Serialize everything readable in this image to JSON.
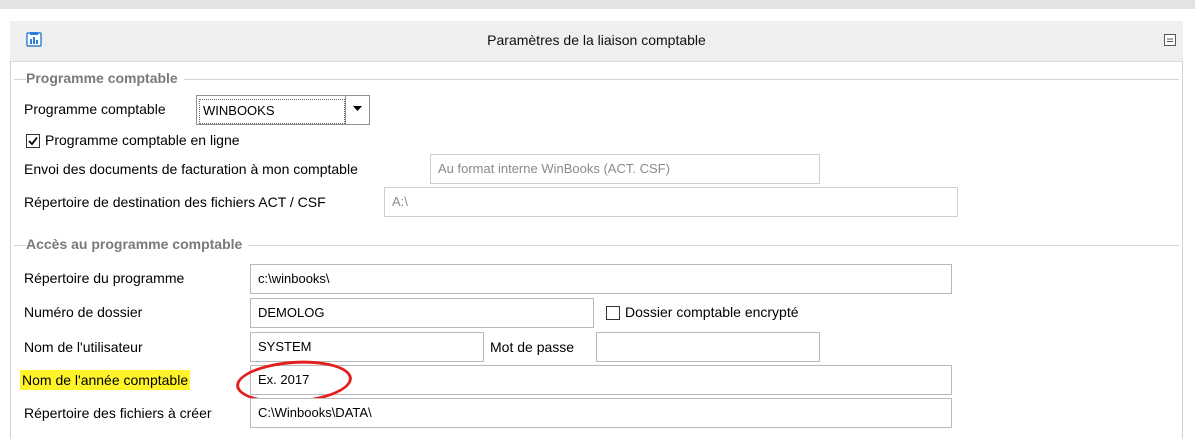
{
  "window": {
    "title": "Paramètres de la liaison comptable"
  },
  "sections": {
    "programme": {
      "heading": "Programme comptable",
      "program_label": "Programme comptable",
      "program_value": "WINBOOKS",
      "online_label": "Programme comptable en ligne",
      "online_checked": true,
      "envoi_label": "Envoi des documents de facturation à mon comptable",
      "envoi_value": "Au format interne WinBooks (ACT. CSF)",
      "repertoire_dest_label": "Répertoire de destination des fichiers ACT / CSF",
      "repertoire_dest_value": "A:\\"
    },
    "acces": {
      "heading": "Accès au programme comptable",
      "rep_prog_label": "Répertoire du programme",
      "rep_prog_value": "c:\\winbooks\\",
      "dossier_label": "Numéro de dossier",
      "dossier_value": "DEMOLOG",
      "encrypte_label": "Dossier comptable encrypté",
      "encrypte_checked": false,
      "user_label": "Nom de l'utilisateur",
      "user_value": "SYSTEM",
      "password_label": "Mot de passe",
      "password_value": "",
      "annee_label": "Nom de l'année comptable",
      "annee_value": "Ex. 2017",
      "rep_fichiers_label": "Répertoire des fichiers à créer",
      "rep_fichiers_value": "C:\\Winbooks\\DATA\\"
    }
  },
  "colors": {
    "highlight": "#fff32a",
    "annotation_circle": "#e31e1e",
    "group_heading": "#7a7a7a"
  },
  "icons": {
    "app": "app-icon",
    "restore": "restore-window-icon",
    "dropdown": "dropdown-arrow-icon",
    "check": "checkmark-icon"
  }
}
